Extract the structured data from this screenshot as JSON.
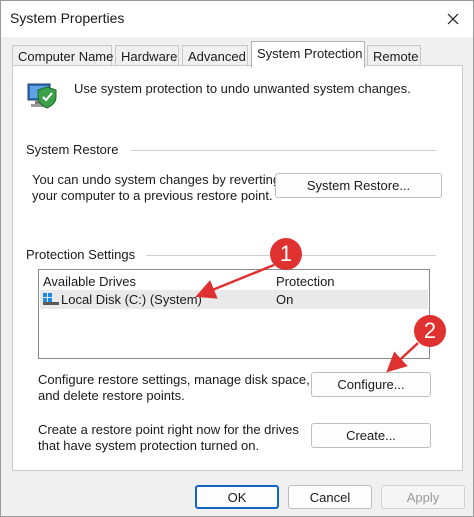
{
  "window": {
    "title": "System Properties"
  },
  "tabs": [
    {
      "label": "Computer Name"
    },
    {
      "label": "Hardware"
    },
    {
      "label": "Advanced"
    },
    {
      "label": "System Protection"
    },
    {
      "label": "Remote"
    }
  ],
  "active_tab": "System Protection",
  "intro": {
    "text": "Use system protection to undo unwanted system changes."
  },
  "system_restore": {
    "group_title": "System Restore",
    "description_line1": "You can undo system changes by reverting",
    "description_line2": "your computer to a previous restore point.",
    "button_label": "System Restore..."
  },
  "protection": {
    "group_title": "Protection Settings",
    "columns": [
      "Available Drives",
      "Protection"
    ],
    "drives": [
      {
        "name": "Local Disk (C:) (System)",
        "protection": "On"
      }
    ],
    "configure_line1": "Configure restore settings, manage disk space,",
    "configure_line2": "and delete restore points.",
    "configure_button": "Configure...",
    "create_line1": "Create a restore point right now for the drives",
    "create_line2": "that have system protection turned on.",
    "create_button": "Create..."
  },
  "footer": {
    "ok": "OK",
    "cancel": "Cancel",
    "apply": "Apply"
  },
  "annotations": [
    {
      "label": "1"
    },
    {
      "label": "2"
    }
  ],
  "colors": {
    "annotation": "#e03131",
    "accent": "#1565c0"
  }
}
